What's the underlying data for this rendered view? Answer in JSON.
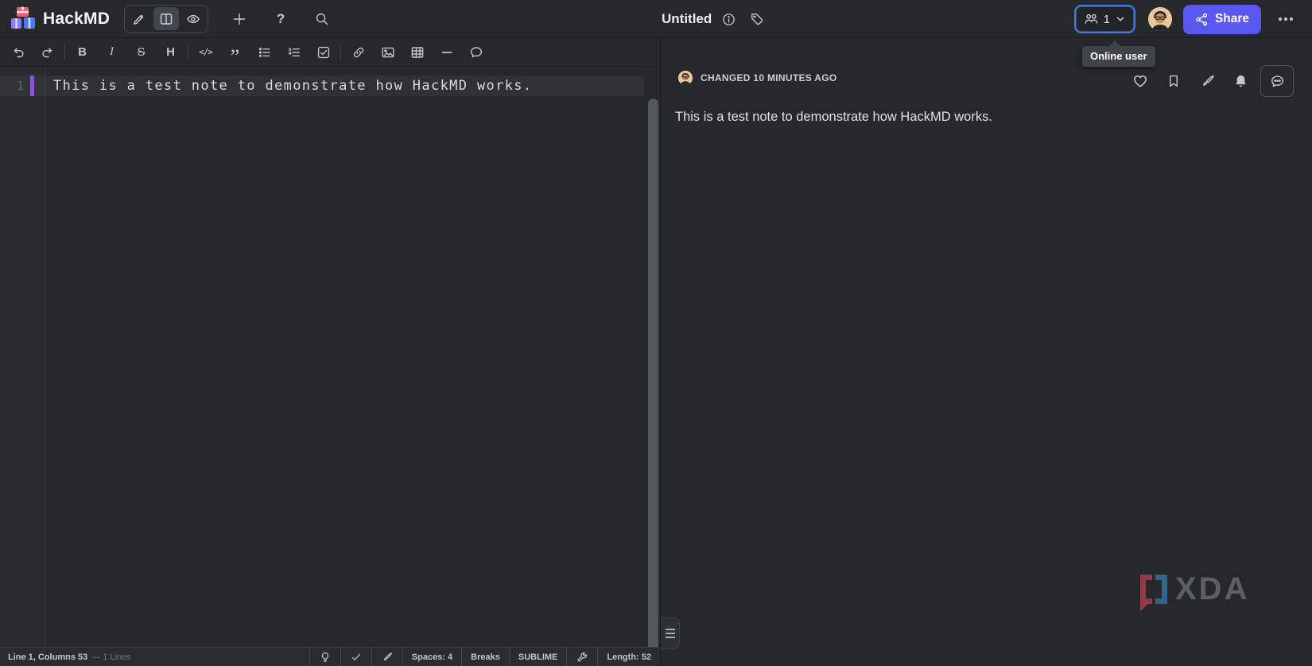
{
  "topbar": {
    "brand": "HackMD",
    "title": "Untitled",
    "online_users": {
      "count": "1",
      "tooltip": "Online user"
    },
    "share_label": "Share",
    "help_glyph": "?"
  },
  "mode_buttons": [
    {
      "name": "edit",
      "icon": "pencil-icon",
      "active": false
    },
    {
      "name": "split",
      "icon": "split-view-icon",
      "active": true
    },
    {
      "name": "view",
      "icon": "eye-icon",
      "active": false
    }
  ],
  "editor": {
    "toolbar_glyphs": {
      "bold": "B",
      "italic": "I",
      "strike": "S",
      "heading": "H",
      "code": "</>",
      "quote": "”"
    },
    "toolbar_icons": [
      "undo-icon",
      "redo-icon",
      "bold",
      "italic",
      "strikethrough",
      "heading",
      "code-block",
      "quote",
      "bullet-list-icon",
      "numbered-list-icon",
      "checklist-icon",
      "link-icon",
      "image-icon",
      "table-icon",
      "horizontal-rule-icon",
      "comment-icon"
    ],
    "line_number": "1",
    "content": "This is a test note to demonstrate how HackMD works.",
    "statusbar": {
      "position": "Line 1, Columns 53",
      "lines": "— 1 Lines",
      "icons": [
        "lightbulb-icon",
        "check-icon",
        "brush-icon",
        "wrench-icon"
      ],
      "spaces": "Spaces: 4",
      "breaks": "Breaks",
      "keymap": "SUBLIME",
      "length": "Length: 52"
    }
  },
  "preview": {
    "changed_label": "CHANGED 10 MINUTES AGO",
    "content": "This is a test note to demonstrate how HackMD works.",
    "action_icons": [
      "heart-icon",
      "bookmark-icon",
      "brush-icon",
      "bell-icon",
      "comment-dots-icon"
    ]
  },
  "watermark": {
    "text": "XDA"
  },
  "colors": {
    "background": "#26282b",
    "share_button": "#5a57f0",
    "focus_ring": "#3b7bf0",
    "change_marker": "#8d55d6",
    "tooltip_bg": "#404348"
  }
}
